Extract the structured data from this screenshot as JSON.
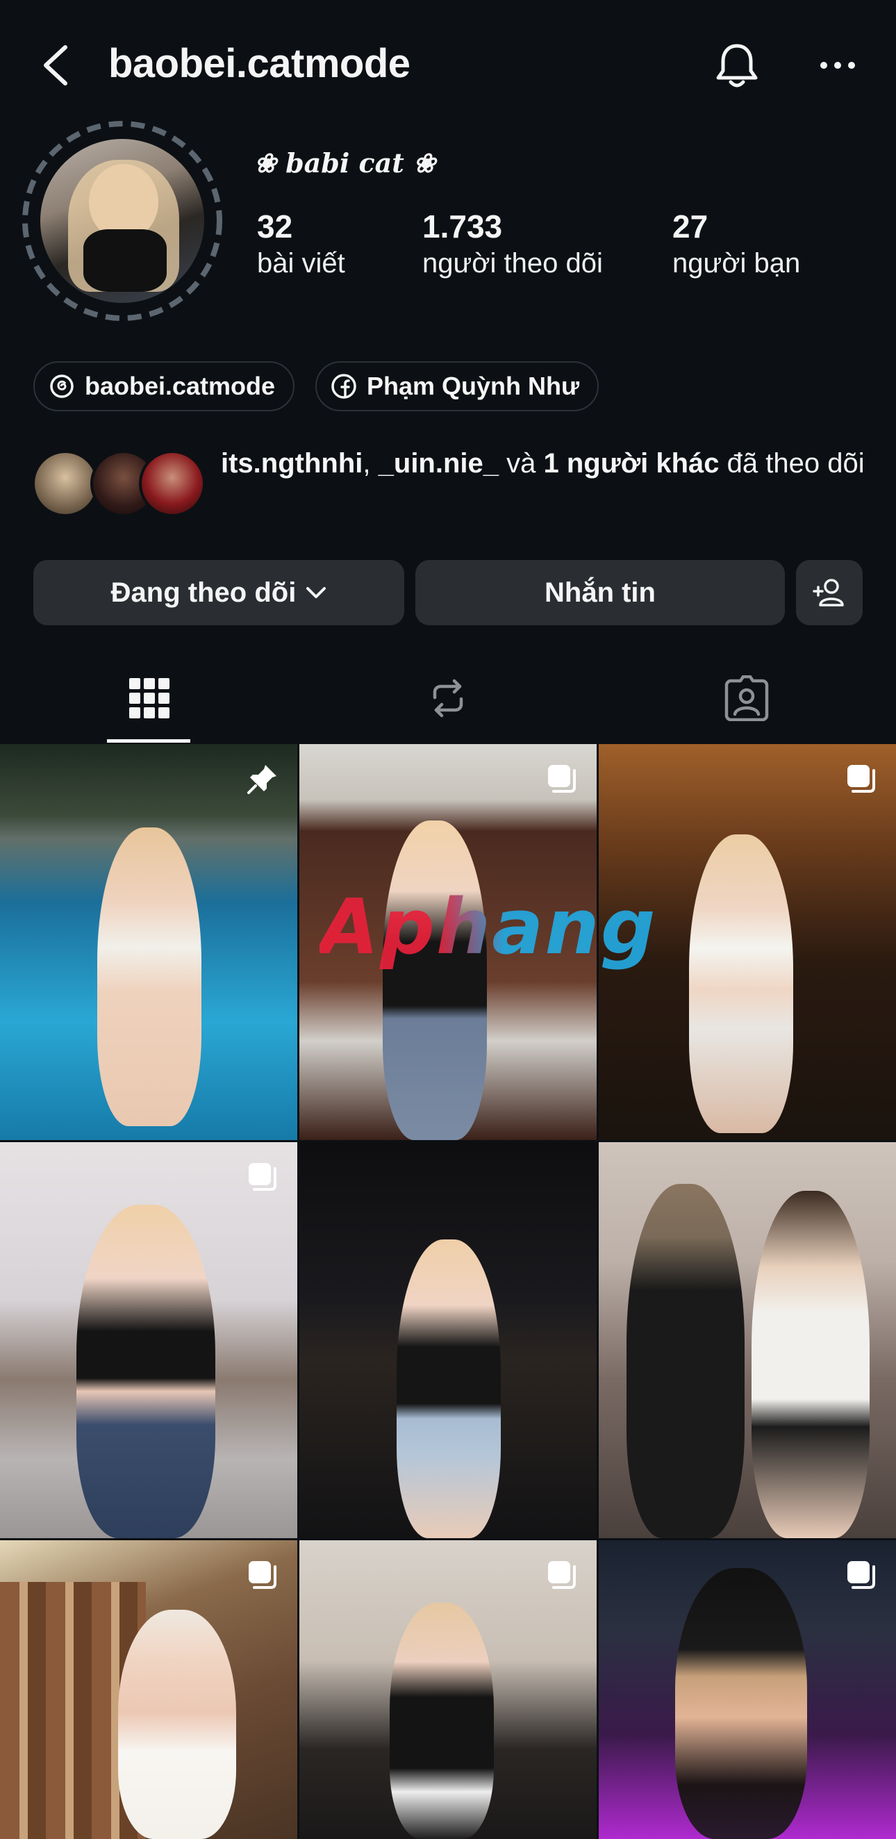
{
  "header": {
    "username": "baobei.catmode",
    "back_icon": "chevron-left-icon",
    "bell_icon": "bell-icon",
    "more_icon": "more-horizontal-icon"
  },
  "profile": {
    "display_name": "❀ babi cat ❀",
    "stats": [
      {
        "value": "32",
        "label": "bài viết"
      },
      {
        "value": "1.733",
        "label": "người theo dõi"
      },
      {
        "value": "27",
        "label": "người bạn"
      }
    ],
    "links": [
      {
        "icon": "threads-icon",
        "label": "baobei.catmode"
      },
      {
        "icon": "facebook-icon",
        "label": "Phạm Quỳnh Như"
      }
    ],
    "followed_by": {
      "user1": "its.ngthnhi",
      "sep": ", ",
      "user2": "_uin.nie_",
      "and": " và ",
      "others": "1 người khác",
      "suffix": " đã theo dõi"
    }
  },
  "actions": {
    "following_label": "Đang theo dõi",
    "message_label": "Nhắn tin",
    "add_user_icon": "person-add-icon"
  },
  "tabs": [
    {
      "name": "grid-icon",
      "active": true
    },
    {
      "name": "reposts-icon",
      "active": false
    },
    {
      "name": "tagged-icon",
      "active": false
    }
  ],
  "watermark": "Aphang",
  "colors": {
    "background": "#0c1014",
    "button": "#2a2e33",
    "text": "#f5f5f5",
    "watermark_red": "#e8213a",
    "watermark_blue": "#23a9e1"
  },
  "posts": [
    {
      "badge": "pin-icon"
    },
    {
      "badge": "carousel-icon"
    },
    {
      "badge": "carousel-icon"
    },
    {
      "badge": "carousel-icon"
    },
    {
      "badge": "none"
    },
    {
      "badge": "none"
    },
    {
      "badge": "carousel-icon"
    },
    {
      "badge": "carousel-icon"
    },
    {
      "badge": "carousel-icon"
    }
  ]
}
